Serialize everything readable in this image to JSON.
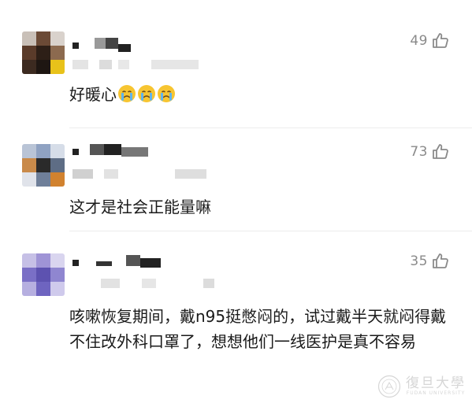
{
  "comments": [
    {
      "likes": "49",
      "text": "好暖心",
      "emoji_count": 3
    },
    {
      "likes": "73",
      "text": "这才是社会正能量嘛"
    },
    {
      "likes": "35",
      "text": "咳嗽恢复期间，戴n95挺憋闷的，试过戴半天就闷得戴不住改外科口罩了，想想他们一线医护是真不容易"
    }
  ],
  "icons": {
    "like": "thumbs-up-outline-icon",
    "emoji": "crying-face-emoji"
  },
  "watermark": {
    "seal": "university-seal",
    "text": "復旦大學",
    "subtext": "FUDAN UNIVERSITY"
  },
  "colors": {
    "like_count": "#8a8a8a",
    "divider": "#ececec",
    "text": "#1a1a1a"
  }
}
